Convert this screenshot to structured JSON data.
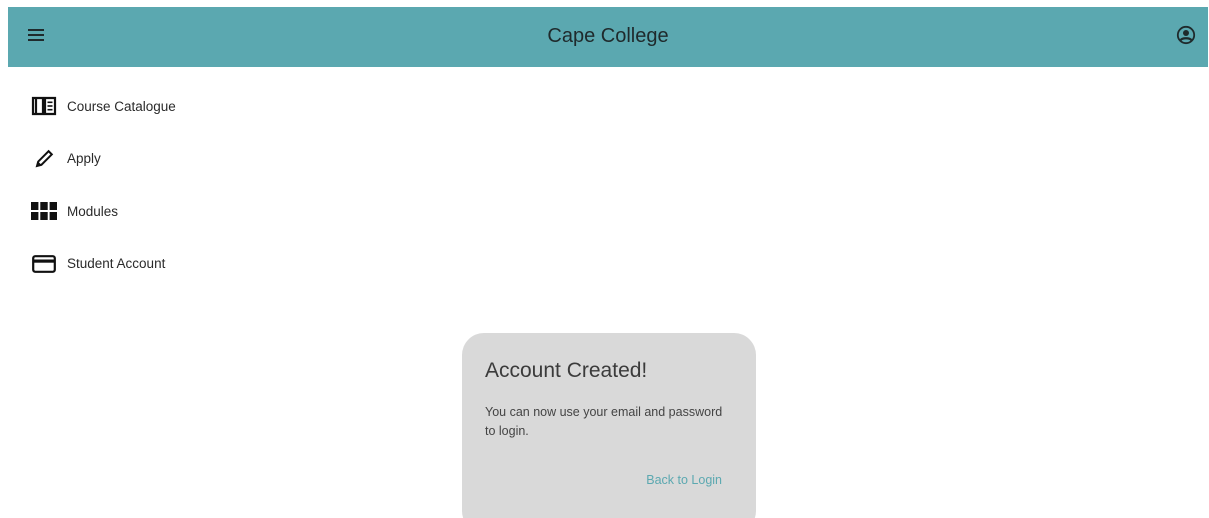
{
  "header": {
    "title": "Cape College",
    "menu_icon": "hamburger-menu-icon",
    "account_icon": "account-circle-icon",
    "background_color": "#5ba8b0"
  },
  "sidebar": {
    "items": [
      {
        "label": "Course Catalogue",
        "icon": "book-icon"
      },
      {
        "label": "Apply",
        "icon": "pencil-icon"
      },
      {
        "label": "Modules",
        "icon": "grid-icon"
      },
      {
        "label": "Student Account",
        "icon": "credit-card-icon"
      }
    ]
  },
  "dialog": {
    "title": "Account Created!",
    "message": "You can now use your email and password to login.",
    "action_label": "Back to Login",
    "background_color": "#d9d9d9",
    "action_color": "#5ba8b0"
  }
}
